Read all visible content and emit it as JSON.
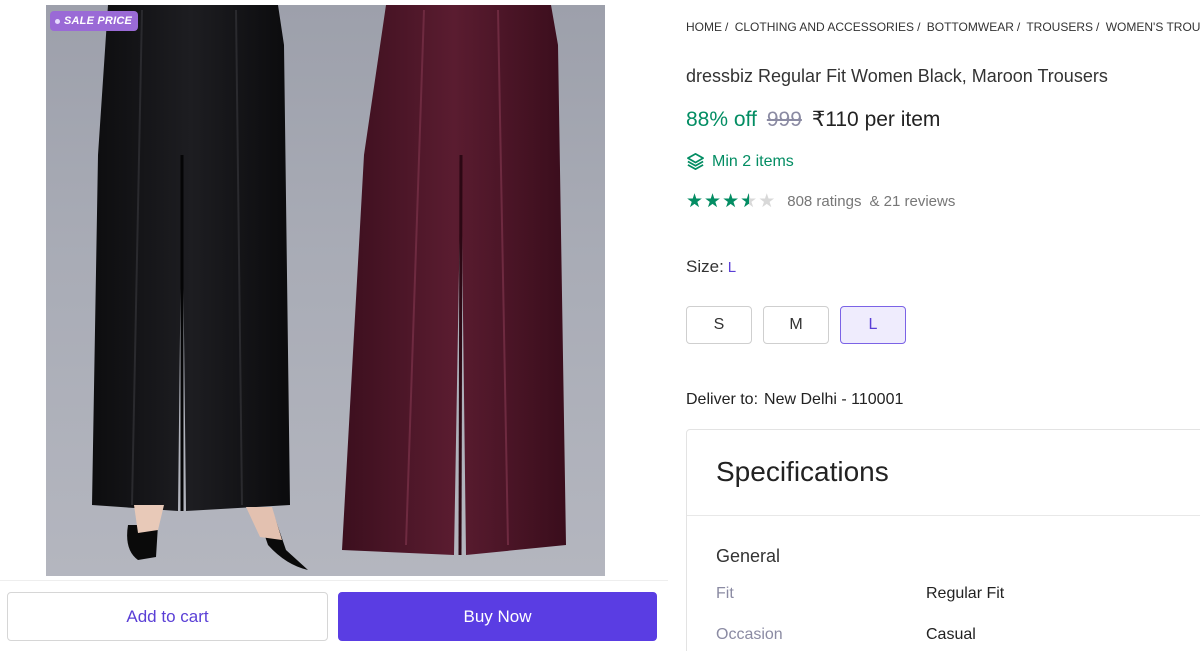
{
  "badge": {
    "label": "SALE PRICE"
  },
  "actions": {
    "add_to_cart": "Add to cart",
    "buy_now": "Buy Now"
  },
  "breadcrumb": [
    "HOME",
    "/",
    "CLOTHING AND ACCESSORIES",
    "/",
    "BOTTOMWEAR",
    "/",
    "TROUSERS",
    "/",
    "WOMEN'S TROUSERS"
  ],
  "product": {
    "title": "dressbiz Regular Fit Women Black, Maroon Trousers",
    "discount": "88% off",
    "mrp": "999",
    "price": "₹110 per item",
    "min_order": "Min 2 items",
    "rating_value": 3.5,
    "ratings_text": "808 ratings",
    "reviews_text": "& 21 reviews"
  },
  "size": {
    "label": "Size:",
    "selected": "L",
    "options": [
      "S",
      "M",
      "L"
    ]
  },
  "delivery": {
    "label": "Deliver to:",
    "value": "New Delhi - 110001"
  },
  "specs": {
    "title": "Specifications",
    "section": "General",
    "rows": [
      {
        "key": "Fit",
        "value": "Regular Fit"
      },
      {
        "key": "Occasion",
        "value": "Casual"
      }
    ]
  },
  "colors": {
    "accent": "#5a3de3",
    "green": "#038d63",
    "badge": "#9a6ad6"
  },
  "icons": {
    "min_order": "layers-icon",
    "rating": "star-icon"
  }
}
